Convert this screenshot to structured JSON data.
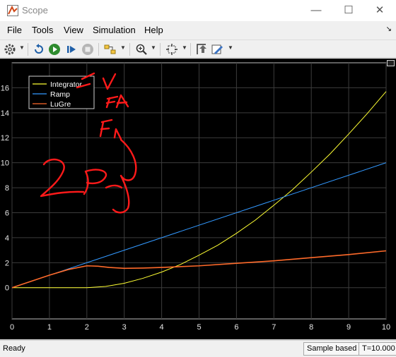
{
  "window": {
    "title": "Scope",
    "minimize_icon": "minimize-icon",
    "maximize_icon": "maximize-icon",
    "close_icon": "close-icon"
  },
  "menu": [
    "File",
    "Tools",
    "View",
    "Simulation",
    "Help"
  ],
  "toolbar": {
    "icons": [
      "gear-icon",
      "step-back-icon",
      "run-icon",
      "step-forward-icon",
      "stop-icon",
      "highlight-block-icon",
      "zoom-icon",
      "fit-to-view-icon",
      "cursor-measurements-icon",
      "style-edit-icon"
    ]
  },
  "status": {
    "left": "Ready",
    "sample": "Sample based",
    "time": "T=10.000"
  },
  "chart_data": {
    "type": "line",
    "title": "",
    "xlabel": "",
    "ylabel": "",
    "xlim": [
      0,
      10
    ],
    "ylim": [
      -2.5,
      18
    ],
    "x_ticks": [
      "0",
      "1",
      "2",
      "3",
      "4",
      "5",
      "6",
      "7",
      "8",
      "9",
      "10"
    ],
    "y_ticks": [
      "0",
      "2",
      "4",
      "6",
      "8",
      "10",
      "12",
      "14",
      "16"
    ],
    "grid": true,
    "legend_position": "top-left",
    "background": "#000000",
    "series": [
      {
        "name": "Integrator",
        "color": "#ffff33",
        "x": [
          0,
          1,
          2,
          2.5,
          3,
          3.5,
          4,
          4.5,
          5,
          5.5,
          6,
          6.5,
          7,
          7.5,
          8,
          8.5,
          9,
          9.5,
          10
        ],
        "y": [
          0,
          0,
          0,
          0.1,
          0.35,
          0.75,
          1.25,
          1.85,
          2.6,
          3.4,
          4.35,
          5.4,
          6.6,
          7.85,
          9.25,
          10.7,
          12.3,
          13.95,
          15.7
        ]
      },
      {
        "name": "Ramp",
        "color": "#3399ff",
        "x": [
          0,
          10
        ],
        "y": [
          0,
          10
        ]
      },
      {
        "name": "LuGre",
        "color": "#ff6a2a",
        "x": [
          0,
          0.5,
          1,
          1.5,
          2,
          2.3,
          2.6,
          3,
          3.5,
          4,
          5,
          6,
          7,
          8,
          9,
          10
        ],
        "y": [
          0,
          0.5,
          1.0,
          1.45,
          1.75,
          1.72,
          1.62,
          1.55,
          1.57,
          1.62,
          1.75,
          1.95,
          2.15,
          2.4,
          2.65,
          2.95
        ]
      }
    ]
  },
  "annotation_colors": {
    "ink": "#ff1a1a"
  }
}
